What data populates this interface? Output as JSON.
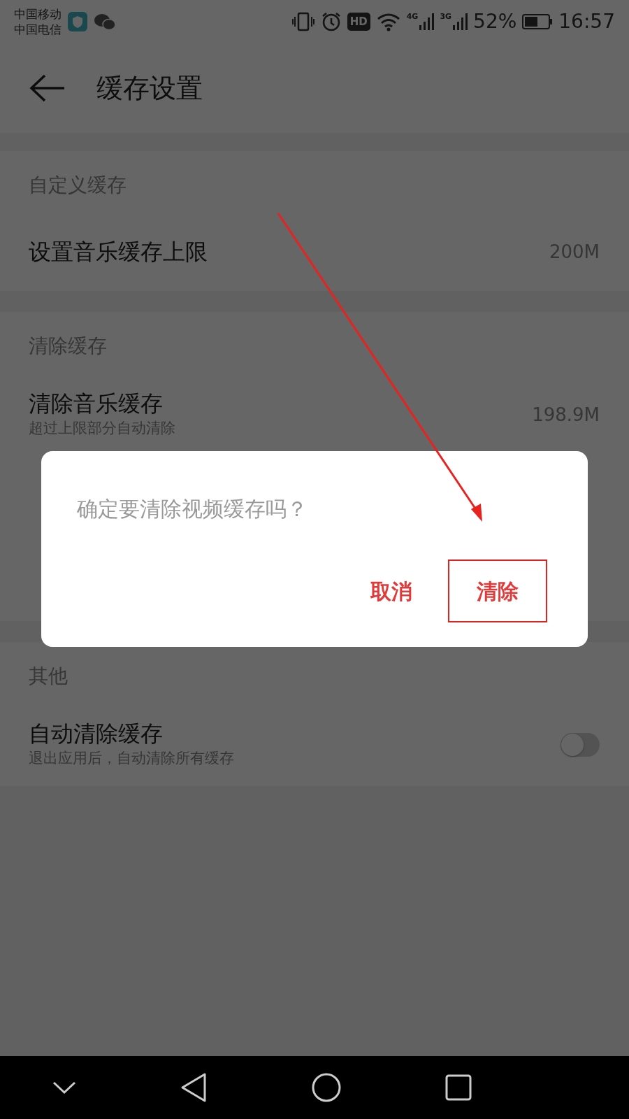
{
  "status_bar": {
    "carriers": [
      "中国移动",
      "中国电信"
    ],
    "hd": "HD",
    "networks": [
      "4G",
      "3G"
    ],
    "battery": "52%",
    "time": "16:57"
  },
  "header": {
    "title": "缓存设置"
  },
  "sections": [
    {
      "title": "自定义缓存",
      "rows": [
        {
          "kind": "value",
          "title": "设置音乐缓存上限",
          "value": "200M"
        }
      ]
    },
    {
      "title": "清除缓存",
      "rows": [
        {
          "kind": "value",
          "title": "清除音乐缓存",
          "subtitle": "超过上限部分自动清除",
          "value": "198.9M"
        }
      ]
    },
    {
      "title": "其他",
      "rows": [
        {
          "kind": "toggle",
          "title": "自动清除缓存",
          "subtitle": "退出应用后，自动清除所有缓存",
          "on": false
        }
      ]
    }
  ],
  "dialog": {
    "message": "确定要清除视频缓存吗？",
    "buttons": [
      {
        "label": "取消",
        "highlighted": false
      },
      {
        "label": "清除",
        "highlighted": true
      }
    ]
  }
}
